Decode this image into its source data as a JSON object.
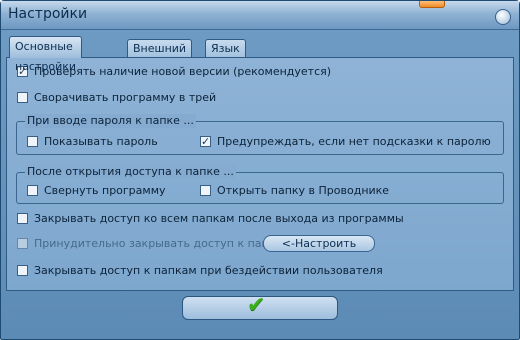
{
  "window": {
    "title": "Настройки"
  },
  "tabs": [
    {
      "label": "Основные настройки",
      "active": true
    },
    {
      "label": "Внешний вид",
      "active": false
    },
    {
      "label": "Язык",
      "active": false
    }
  ],
  "options": {
    "check_version": {
      "label": "Проверять наличие новой версии  (рекомендуется)",
      "checked": true
    },
    "minimize_tray": {
      "label": "Сворачивать программу в трей",
      "checked": false
    },
    "close_all_on_exit": {
      "label": "Закрывать доступ ко всем папкам после выхода из программы",
      "checked": false
    },
    "force_close": {
      "label": "Принудительно закрывать доступ к папкам",
      "checked": false,
      "disabled": true
    },
    "close_on_idle": {
      "label": "Закрывать доступ к папкам при бездействии пользователя",
      "checked": false
    }
  },
  "password_group": {
    "title": "При вводе пароля к папке ...",
    "show_password": {
      "label": "Показывать пароль",
      "checked": false
    },
    "warn_no_hint": {
      "label": "Предупреждать, если нет подсказки к паролю",
      "checked": true
    }
  },
  "open_group": {
    "title": "После открытия доступа к папке ...",
    "minimize_program": {
      "label": "Свернуть программу",
      "checked": false
    },
    "open_in_explorer": {
      "label": "Открыть папку в Проводнике",
      "checked": false
    }
  },
  "buttons": {
    "configure_label": "<-Настроить",
    "ok_icon": "checkmark-icon"
  },
  "colors": {
    "accent_green": "#3cae1e",
    "panel_blue": "#85abd1"
  }
}
